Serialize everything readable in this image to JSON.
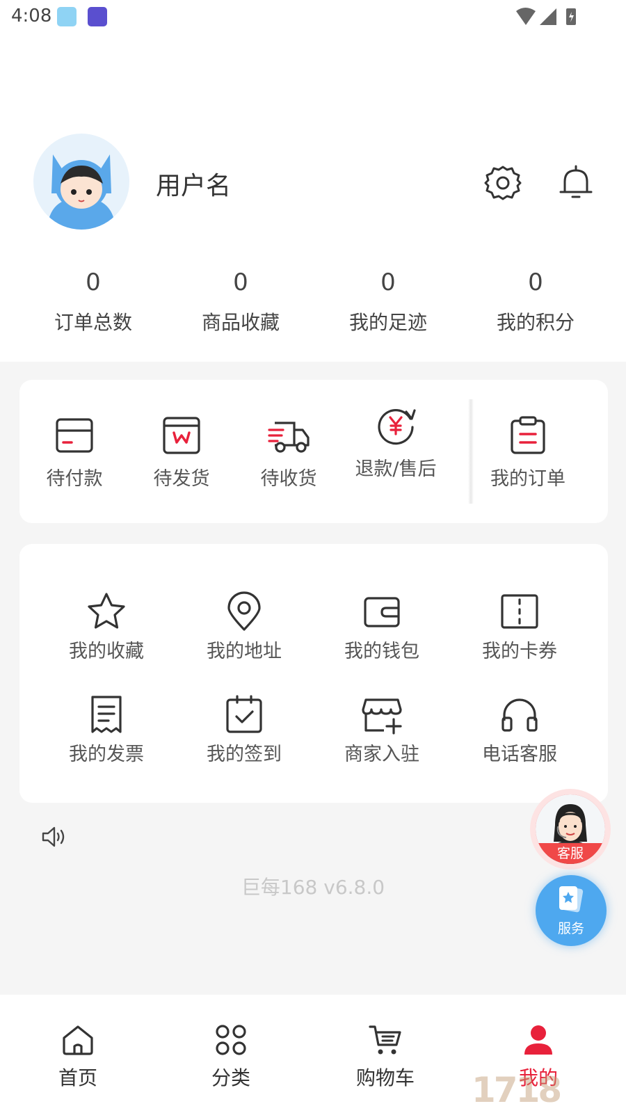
{
  "status_bar": {
    "time": "4:08"
  },
  "profile": {
    "username": "用户名"
  },
  "stats": [
    {
      "value": "0",
      "label": "订单总数"
    },
    {
      "value": "0",
      "label": "商品收藏"
    },
    {
      "value": "0",
      "label": "我的足迹"
    },
    {
      "value": "0",
      "label": "我的积分"
    }
  ],
  "orders": {
    "pending_payment": "待付款",
    "pending_shipment": "待发货",
    "pending_receipt": "待收货",
    "refund": "退款/售后",
    "my_orders": "我的订单"
  },
  "tools": {
    "favorites": "我的收藏",
    "address": "我的地址",
    "wallet": "我的钱包",
    "coupons": "我的卡券",
    "invoice": "我的发票",
    "checkin": "我的签到",
    "merchant": "商家入驻",
    "phone_service": "电话客服"
  },
  "version": "巨每168 v6.8.0",
  "floating": {
    "kefu": "客服",
    "service": "服务"
  },
  "tabbar": {
    "home": "首页",
    "category": "分类",
    "cart": "购物车",
    "mine": "我的"
  },
  "colors": {
    "accent": "#e8213b",
    "service_blue": "#4ea8ef"
  },
  "watermark": "1718"
}
